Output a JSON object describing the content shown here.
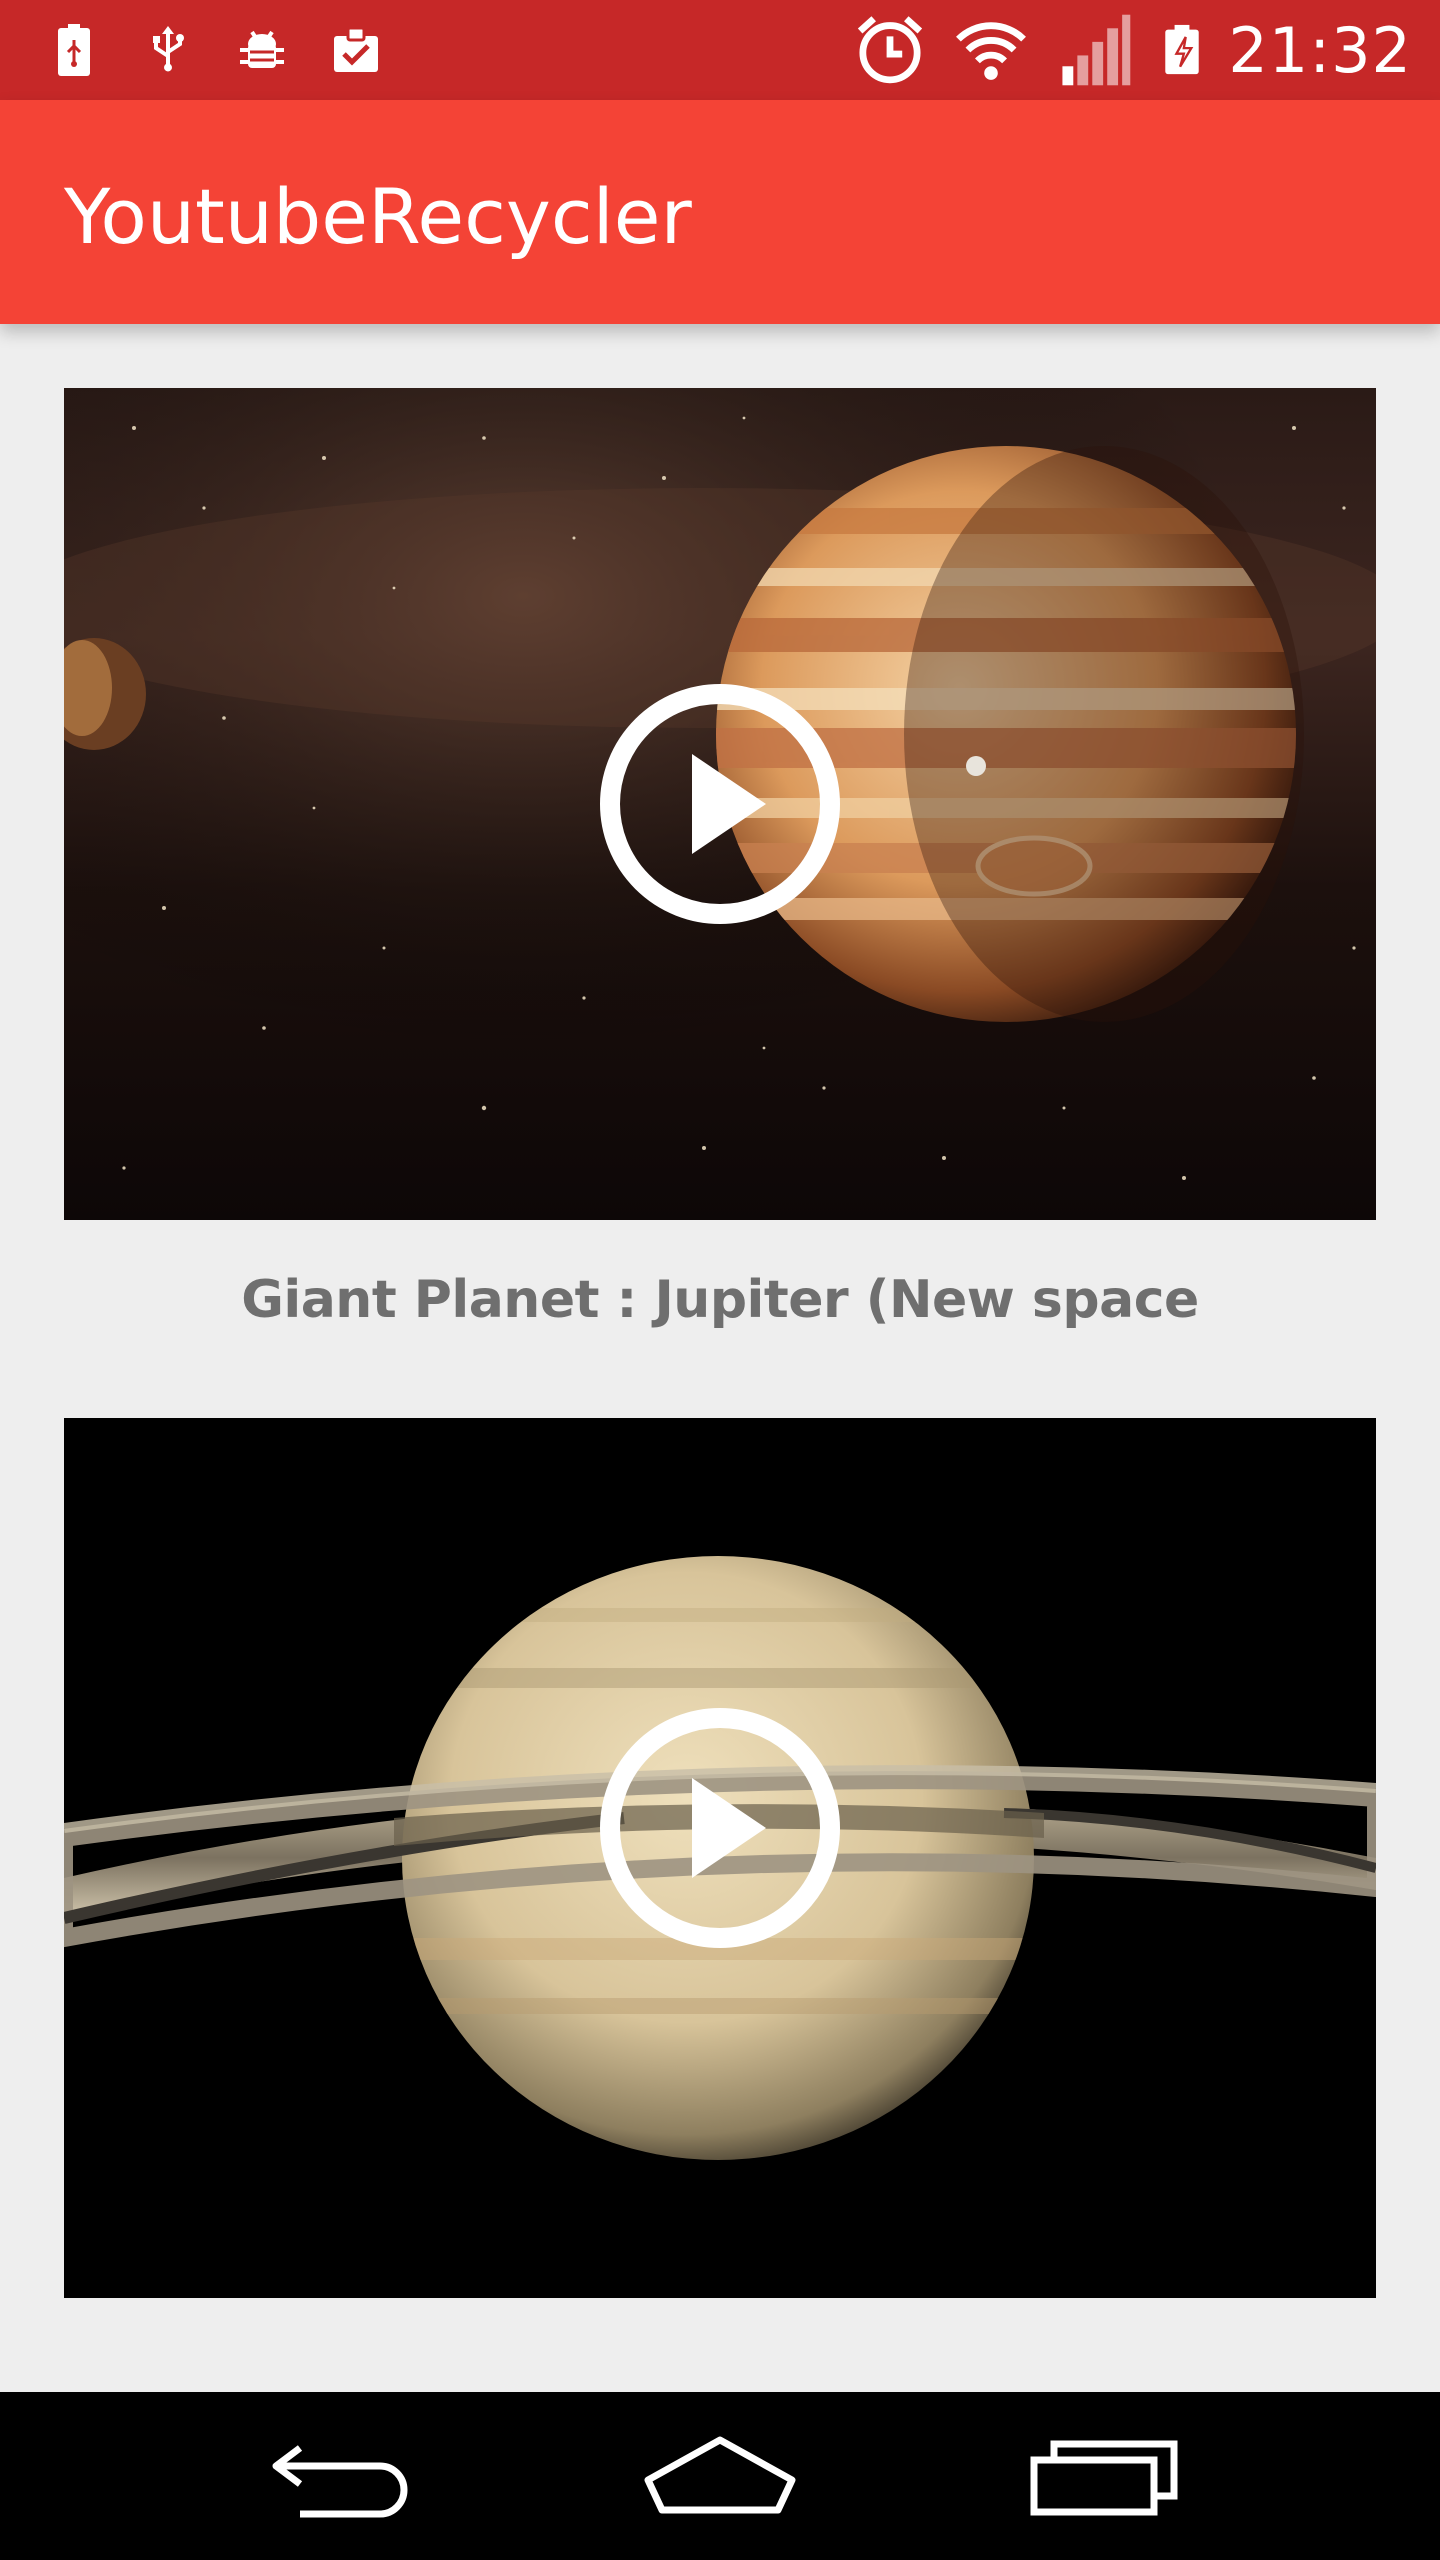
{
  "status_bar": {
    "time": "21:32",
    "left_icons": [
      "battery-usb-icon",
      "usb-icon",
      "android-debug-icon",
      "clipboard-check-icon"
    ],
    "right_icons": [
      "alarm-icon",
      "wifi-icon",
      "signal-icon",
      "battery-charging-icon"
    ]
  },
  "app_bar": {
    "title": "YoutubeRecycler",
    "background": "#f44336",
    "status_background": "#c62828"
  },
  "videos": [
    {
      "title": "Giant Planet : Jupiter (New space documentary)",
      "thumbnail": "jupiter-thumbnail"
    },
    {
      "title": "",
      "thumbnail": "saturn-thumbnail"
    }
  ],
  "nav_bar": {
    "buttons": [
      "back-icon",
      "home-icon",
      "recents-icon"
    ]
  }
}
